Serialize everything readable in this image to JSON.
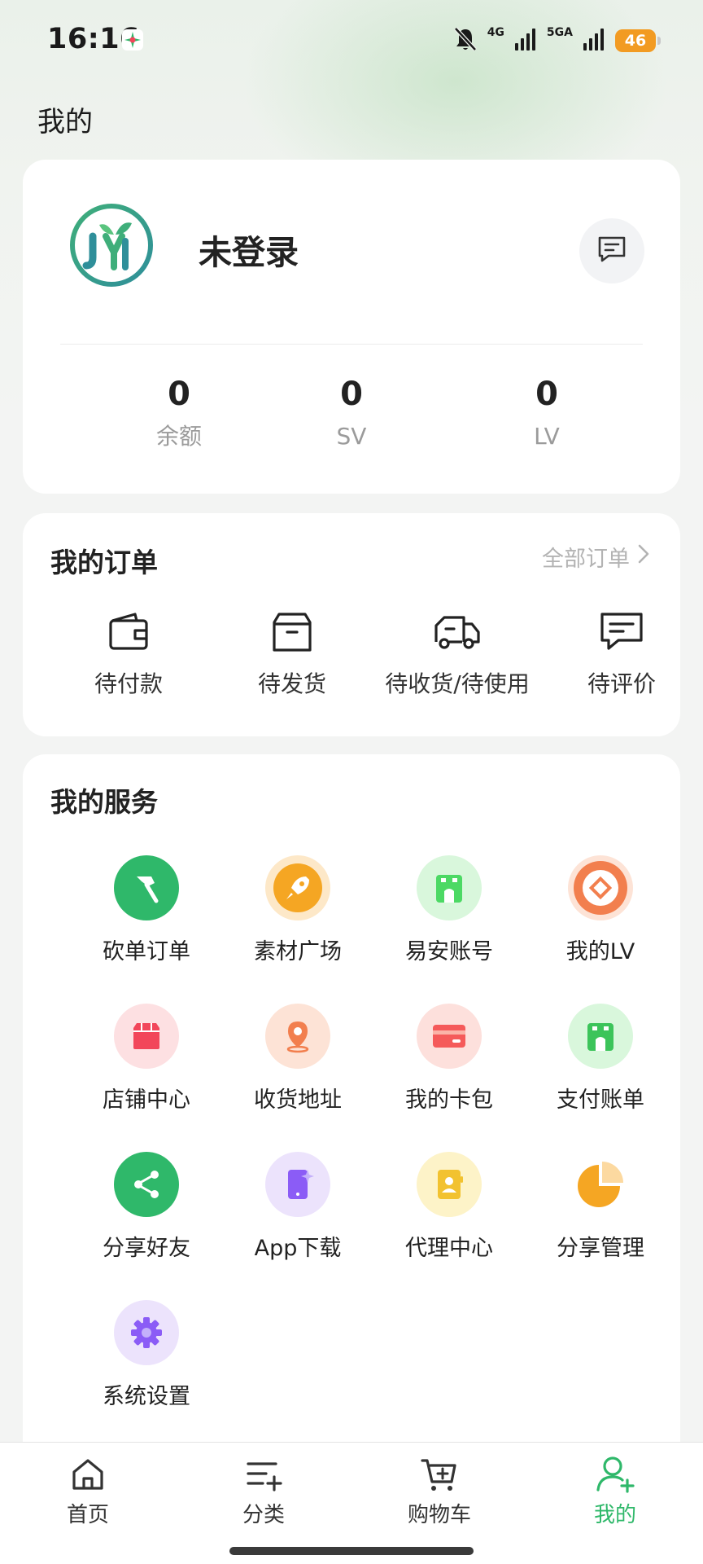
{
  "status_bar": {
    "time": "16:16",
    "network_1": "4G",
    "network_2": "5GA",
    "battery": "46"
  },
  "page": {
    "title": "我的"
  },
  "profile": {
    "username": "未登录",
    "stats": [
      {
        "value": "0",
        "label": "余额"
      },
      {
        "value": "0",
        "label": "SV"
      },
      {
        "value": "0",
        "label": "LV"
      }
    ]
  },
  "orders": {
    "title": "我的订单",
    "all_link": "全部订单",
    "items": [
      {
        "label": "待付款",
        "icon": "wallet-icon"
      },
      {
        "label": "待发货",
        "icon": "box-icon"
      },
      {
        "label": "待收货/待使用",
        "icon": "truck-icon"
      },
      {
        "label": "待评价",
        "icon": "comment-icon"
      }
    ]
  },
  "services": {
    "title": "我的服务",
    "items": [
      {
        "label": "砍单订单",
        "icon": "axe-icon",
        "color": "#2fb86a"
      },
      {
        "label": "素材广场",
        "icon": "rocket-icon",
        "color": "#f5a623"
      },
      {
        "label": "易安账号",
        "icon": "shop-icon",
        "color": "#4cd964"
      },
      {
        "label": "我的LV",
        "icon": "diamond-icon",
        "color": "#f27f4e"
      },
      {
        "label": "店铺中心",
        "icon": "store-icon",
        "color": "#f2465a"
      },
      {
        "label": "收货地址",
        "icon": "location-icon",
        "color": "#f27f4e"
      },
      {
        "label": "我的卡包",
        "icon": "card-icon",
        "color": "#f55a5a"
      },
      {
        "label": "支付账单",
        "icon": "bill-icon",
        "color": "#3cc45a"
      },
      {
        "label": "分享好友",
        "icon": "share-icon",
        "color": "#2fb86a"
      },
      {
        "label": "App下载",
        "icon": "phone-icon",
        "color": "#8b5cf6"
      },
      {
        "label": "代理中心",
        "icon": "contacts-icon",
        "color": "#f2c230"
      },
      {
        "label": "分享管理",
        "icon": "pie-chart-icon",
        "color": "#f5a623"
      },
      {
        "label": "系统设置",
        "icon": "settings-icon",
        "color": "#8b5cf6"
      }
    ]
  },
  "tab_bar": {
    "items": [
      {
        "label": "首页",
        "icon": "home-icon"
      },
      {
        "label": "分类",
        "icon": "category-icon"
      },
      {
        "label": "购物车",
        "icon": "cart-icon"
      },
      {
        "label": "我的",
        "icon": "user-add-icon",
        "active": true
      }
    ],
    "accent_color": "#2fb86a"
  }
}
